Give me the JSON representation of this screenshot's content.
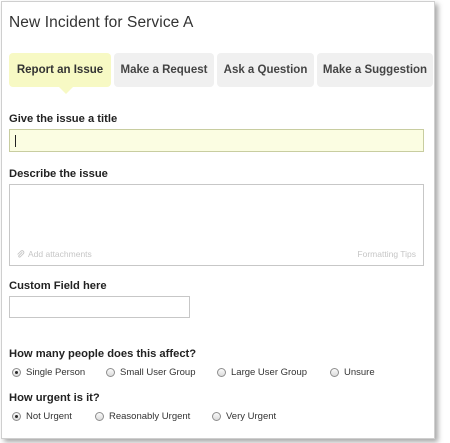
{
  "window": {
    "title": "New Incident for Service A"
  },
  "tabs": [
    {
      "label": "Report an Issue",
      "active": true
    },
    {
      "label": "Make a Request",
      "active": false
    },
    {
      "label": "Ask a Question",
      "active": false
    },
    {
      "label": "Make a Suggestion",
      "active": false
    }
  ],
  "issue_title": {
    "label": "Give the issue a title",
    "value": ""
  },
  "description": {
    "label": "Describe the issue",
    "value": "",
    "attach_label": "Add attachments",
    "formatting_label": "Formatting Tips"
  },
  "custom_field": {
    "label": "Custom Field here",
    "value": ""
  },
  "people_affected": {
    "label": "How many people does this affect?",
    "options": [
      "Single Person",
      "Small User Group",
      "Large User Group",
      "Unsure"
    ],
    "selected": "Single Person"
  },
  "urgency": {
    "label": "How urgent is it?",
    "options": [
      "Not Urgent",
      "Reasonably Urgent",
      "Very Urgent"
    ],
    "selected": "Not Urgent"
  },
  "colors": {
    "active_tab": "#f7f9c4",
    "focused_input": "#fbfde2",
    "tab_bg": "#f0f0f0"
  },
  "icons": {
    "attach": "paperclip-icon"
  }
}
